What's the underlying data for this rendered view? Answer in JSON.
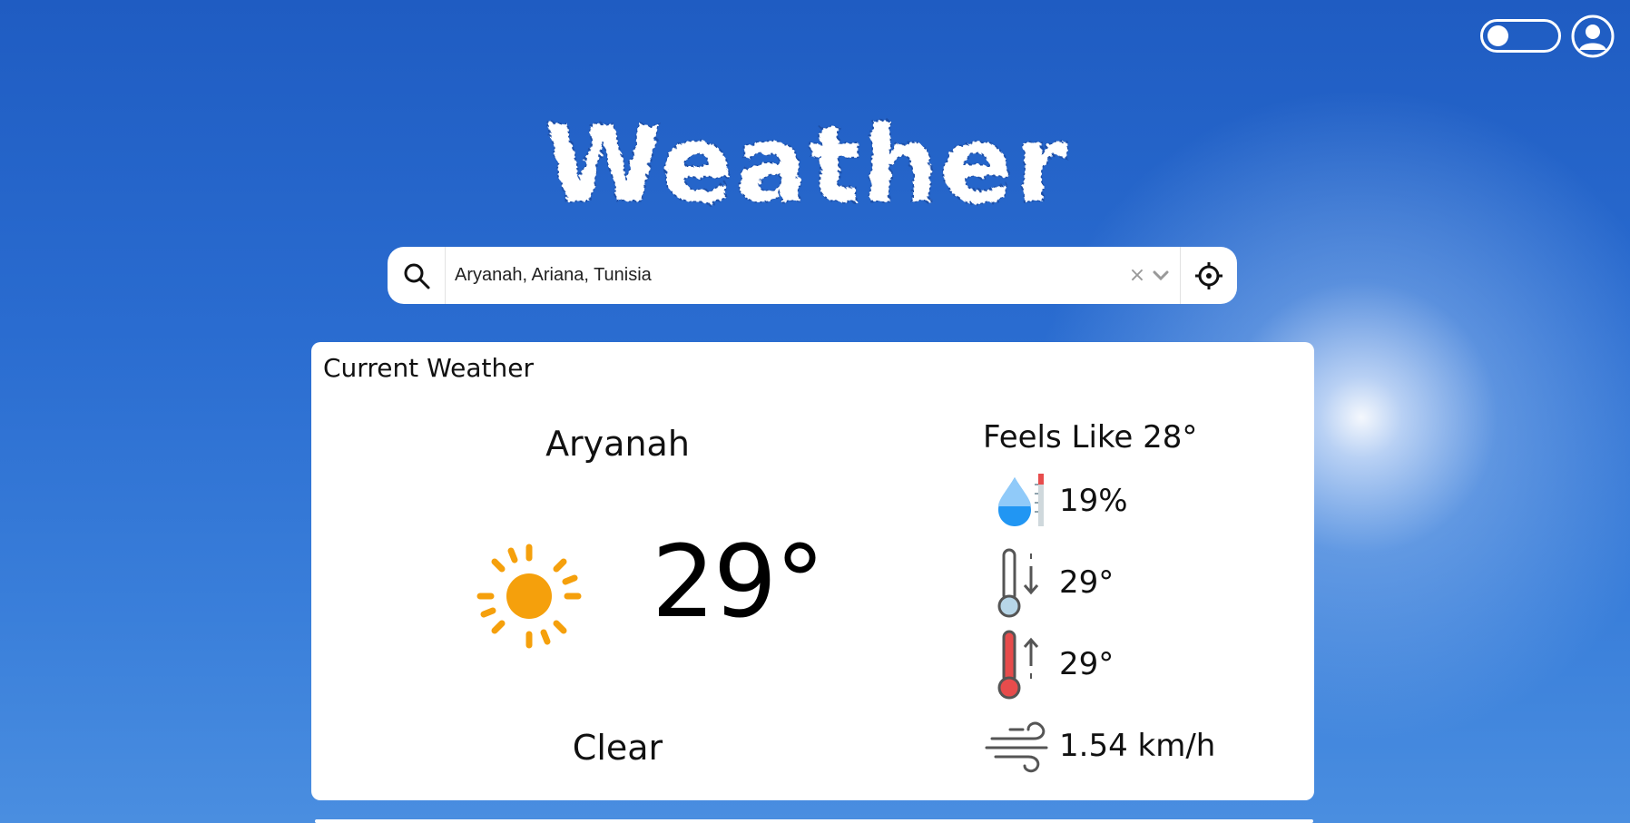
{
  "app": {
    "logo_text": "Weather"
  },
  "header": {
    "theme_toggle_state": "off",
    "user_icon": "user-icon"
  },
  "search": {
    "value": "Aryanah, Ariana, Tunisia",
    "clear_glyph": "×",
    "search_icon": "search-icon",
    "location_icon": "crosshair-icon"
  },
  "current": {
    "title": "Current Weather",
    "city": "Aryanah",
    "temperature": "29°",
    "condition": "Clear",
    "condition_icon": "sun-icon",
    "feels_like": "Feels Like 28°",
    "humidity": "19%",
    "min_temp": "29°",
    "max_temp": "29°",
    "wind": "1.54 km/h"
  },
  "colors": {
    "sun": "#f5a00c",
    "humidity_drop": "#2196f3",
    "thermo_cold": "#b7d6e8",
    "thermo_hot": "#e74c4c"
  }
}
